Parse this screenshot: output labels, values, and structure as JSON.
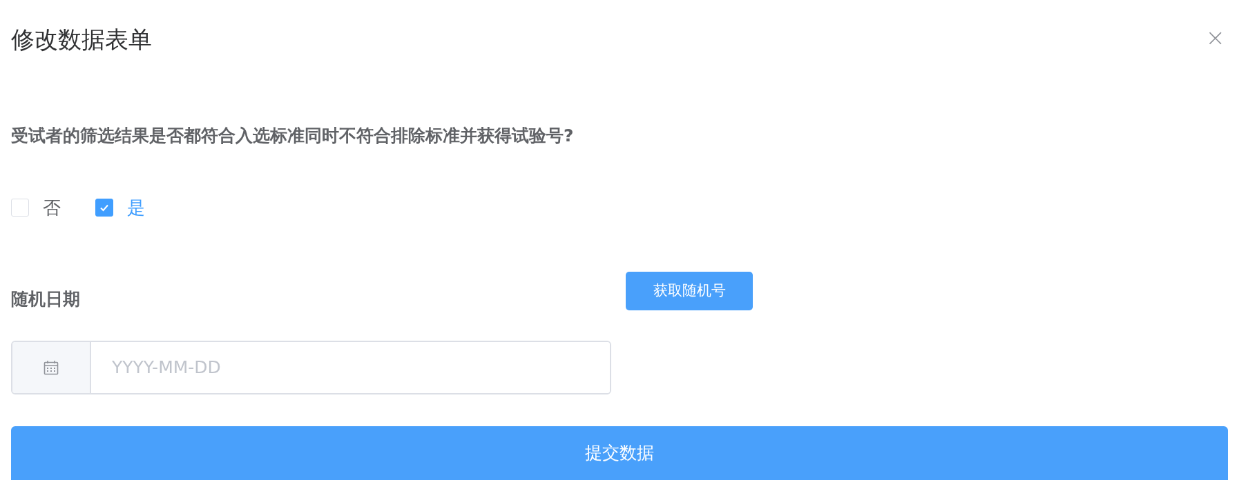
{
  "dialog": {
    "title": "修改数据表单",
    "close": "×"
  },
  "question": {
    "text": "受试者的筛选结果是否都符合入选标准同时不符合排除标准并获得试验号?",
    "options": [
      {
        "label": "否",
        "checked": false
      },
      {
        "label": "是",
        "checked": true
      }
    ]
  },
  "random_button": "获取随机号",
  "date": {
    "label": "随机日期",
    "placeholder": "YYYY-MM-DD"
  },
  "submit": "提交数据"
}
